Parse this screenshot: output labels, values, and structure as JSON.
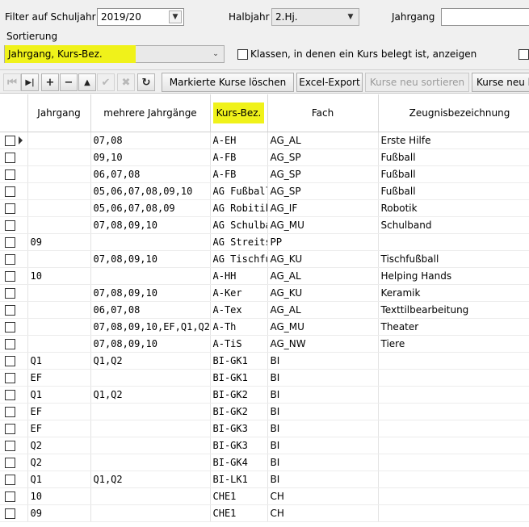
{
  "filter": {
    "schuljahr_label": "Filter auf Schuljahr",
    "schuljahr_value": "2019/20",
    "halbjahr_label": "Halbjahr",
    "halbjahr_value": "2.Hj.",
    "jahrgang_label": "Jahrgang",
    "jahrgang_value": ""
  },
  "sort": {
    "label": "Sortierung",
    "value": "Jahrgang, Kurs-Bez.",
    "highlight_color": "#f0f21a"
  },
  "options": {
    "klassen_label": "Klassen, in denen ein Kurs belegt ist, anzeigen"
  },
  "toolbar": {
    "nav_first_icon": "⏮",
    "nav_last_icon": "▶|",
    "add_icon": "+",
    "remove_icon": "−",
    "up_icon": "▲",
    "confirm_icon": "✔",
    "cancel_icon": "✖",
    "refresh_icon": "↻",
    "delete_marked_label": "Markierte Kurse löschen",
    "excel_export_label": "Excel-Export",
    "resort_label": "Kurse neu sortieren",
    "kurse_neu_label": "Kurse neu l"
  },
  "grid": {
    "columns": [
      "",
      "Jahrgang",
      "mehrere Jahrgänge",
      "Kurs-Bez.",
      "Fach",
      "Zeugnisbezeichnung"
    ],
    "rows": [
      {
        "jahrgang": "",
        "mehrere": "07,08",
        "kurs": "A-EH",
        "fach": "AG_AL",
        "zeugnis": "Erste Hilfe"
      },
      {
        "jahrgang": "",
        "mehrere": "09,10",
        "kurs": "A-FB",
        "fach": "AG_SP",
        "zeugnis": "Fußball"
      },
      {
        "jahrgang": "",
        "mehrere": "06,07,08",
        "kurs": "A-FB",
        "fach": "AG_SP",
        "zeugnis": "Fußball"
      },
      {
        "jahrgang": "",
        "mehrere": "05,06,07,08,09,10",
        "kurs": "AG Fußball",
        "fach": "AG_SP",
        "zeugnis": "Fußball"
      },
      {
        "jahrgang": "",
        "mehrere": "05,06,07,08,09",
        "kurs": "AG Robitik",
        "fach": "AG_IF",
        "zeugnis": " Robotik"
      },
      {
        "jahrgang": "",
        "mehrere": "07,08,09,10",
        "kurs": "AG Schulband",
        "fach": "AG_MU",
        "zeugnis": "Schulband"
      },
      {
        "jahrgang": "09",
        "mehrere": "",
        "kurs": "AG Streitschlichter",
        "fach": "PP",
        "zeugnis": ""
      },
      {
        "jahrgang": "",
        "mehrere": "07,08,09,10",
        "kurs": "AG Tischfußball",
        "fach": "AG_KU",
        "zeugnis": "Tischfußball"
      },
      {
        "jahrgang": "10",
        "mehrere": "",
        "kurs": "A-HH",
        "fach": "AG_AL",
        "zeugnis": "Helping Hands"
      },
      {
        "jahrgang": "",
        "mehrere": "07,08,09,10",
        "kurs": "A-Ker",
        "fach": "AG_KU",
        "zeugnis": "Keramik"
      },
      {
        "jahrgang": "",
        "mehrere": "06,07,08",
        "kurs": "A-Tex",
        "fach": "AG_AL",
        "zeugnis": "Texttilbearbeitung"
      },
      {
        "jahrgang": "",
        "mehrere": "07,08,09,10,EF,Q1,Q2",
        "kurs": "A-Th",
        "fach": "AG_MU",
        "zeugnis": "Theater"
      },
      {
        "jahrgang": "",
        "mehrere": "07,08,09,10",
        "kurs": "A-TiS",
        "fach": "AG_NW",
        "zeugnis": "Tiere"
      },
      {
        "jahrgang": "Q1",
        "mehrere": "Q1,Q2",
        "kurs": "BI-GK1",
        "fach": "BI",
        "zeugnis": ""
      },
      {
        "jahrgang": "EF",
        "mehrere": "",
        "kurs": "BI-GK1",
        "fach": "BI",
        "zeugnis": ""
      },
      {
        "jahrgang": "Q1",
        "mehrere": "Q1,Q2",
        "kurs": "BI-GK2",
        "fach": "BI",
        "zeugnis": ""
      },
      {
        "jahrgang": "EF",
        "mehrere": "",
        "kurs": "BI-GK2",
        "fach": "BI",
        "zeugnis": ""
      },
      {
        "jahrgang": "EF",
        "mehrere": "",
        "kurs": "BI-GK3",
        "fach": "BI",
        "zeugnis": ""
      },
      {
        "jahrgang": "Q2",
        "mehrere": "",
        "kurs": "BI-GK3",
        "fach": "BI",
        "zeugnis": ""
      },
      {
        "jahrgang": "Q2",
        "mehrere": "",
        "kurs": "BI-GK4",
        "fach": "BI",
        "zeugnis": ""
      },
      {
        "jahrgang": "Q1",
        "mehrere": "Q1,Q2",
        "kurs": "BI-LK1",
        "fach": "BI",
        "zeugnis": ""
      },
      {
        "jahrgang": "10",
        "mehrere": "",
        "kurs": "CHE1",
        "fach": "CH",
        "zeugnis": ""
      },
      {
        "jahrgang": "09",
        "mehrere": "",
        "kurs": "CHE1",
        "fach": "CH",
        "zeugnis": ""
      }
    ]
  }
}
